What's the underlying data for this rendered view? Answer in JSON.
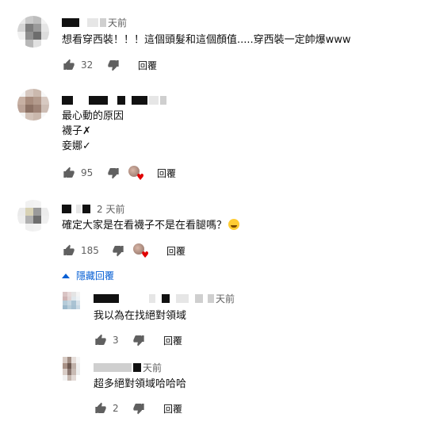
{
  "colors": {
    "accent": "#065fd4",
    "text": "#0f0f0f",
    "meta": "#606060",
    "heart": "#e00000"
  },
  "comments": [
    {
      "time": "天前",
      "text": "想看穿西裝！！！這個頭髮和這個顏值.....穿西裝一定帥爆www",
      "likes": "32",
      "reply_label": "回覆"
    },
    {
      "time": "",
      "text_lines": [
        "最心動的原因",
        "襪子✗",
        "妾娜✓"
      ],
      "likes": "95",
      "reply_label": "回覆"
    },
    {
      "time": "2 天前",
      "text": "確定大家是在看襪子不是在看腿嗎？",
      "emoji": "face-with-tears-of-joy",
      "likes": "185",
      "reply_label": "回覆"
    }
  ],
  "hide_replies_label": "隱藏回覆",
  "replies": [
    {
      "time": "天前",
      "text": "我以為在找絕對領域",
      "likes": "3",
      "reply_label": "回覆"
    },
    {
      "time": "天前",
      "text": "超多絕對領域哈哈哈",
      "likes": "2",
      "reply_label": "回覆"
    }
  ]
}
